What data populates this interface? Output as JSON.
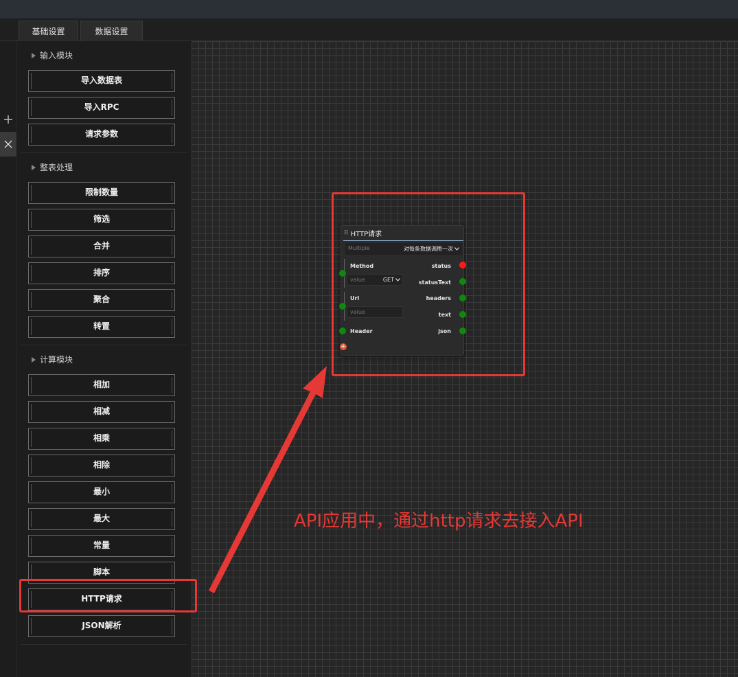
{
  "tabs": [
    {
      "label": "基础设置"
    },
    {
      "label": "数据设置"
    }
  ],
  "rail": {
    "add_icon": "plus-icon",
    "close_icon": "close-icon"
  },
  "sidebar": {
    "sections": [
      {
        "title": "输入模块",
        "items": [
          "导入数据表",
          "导入RPC",
          "请求参数"
        ]
      },
      {
        "title": "整表处理",
        "items": [
          "限制数量",
          "筛选",
          "合并",
          "排序",
          "聚合",
          "转置"
        ]
      },
      {
        "title": "计算模块",
        "items": [
          "相加",
          "相减",
          "相乘",
          "相除",
          "最小",
          "最大",
          "常量",
          "脚本",
          "HTTP请求",
          "JSON解析"
        ]
      }
    ]
  },
  "node": {
    "title": "HTTP请求",
    "mode_placeholder": "Multiple",
    "mode_value": "对每条数据调用一次",
    "inputs": {
      "method_label": "Method",
      "method_placeholder": "value",
      "method_value": "GET",
      "url_label": "Url",
      "url_placeholder": "value",
      "header_label": "Header"
    },
    "outputs": [
      "status",
      "statusText",
      "headers",
      "text",
      "json"
    ]
  },
  "annotation": {
    "text": "API应用中，通过http请求去接入API",
    "color": "#e53935"
  },
  "colors": {
    "port_green": "#0d8a0d",
    "port_red": "#ff1a1a",
    "highlight": "#e53935"
  }
}
